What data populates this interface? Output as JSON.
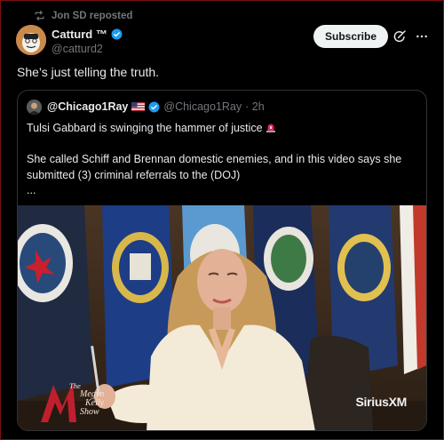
{
  "repost": {
    "text": "Jon SD reposted",
    "icon": "repost-icon"
  },
  "author": {
    "name": "Catturd ™",
    "handle": "@catturd2",
    "verified": true
  },
  "actions": {
    "subscribe_label": "Subscribe",
    "grok_icon": "grok-icon",
    "more_icon": "more-icon"
  },
  "tweet": {
    "text": "She’s just telling the truth."
  },
  "quoted": {
    "name": "@Chicago1Ray",
    "handle": "@Chicago1Ray",
    "time": "· 2h",
    "flag": "us-flag",
    "line1": "Tulsi Gabbard is swinging the hammer of justice",
    "line2": "She called Schiff and Brennan domestic enemies, and in this video says she submitted (3) criminal referrals to the (DOJ)",
    "line3": "...",
    "video": {
      "watermark": "SiriusXM",
      "show_logo_l1": "The",
      "show_logo_l2": "Megyn",
      "show_logo_l3": "Kelly",
      "show_logo_l4": "Show"
    }
  },
  "colors": {
    "background": "#000000",
    "text": "#e7e9ea",
    "muted": "#71767b",
    "verified": "#1d9bf0",
    "border": "#2f3336"
  }
}
